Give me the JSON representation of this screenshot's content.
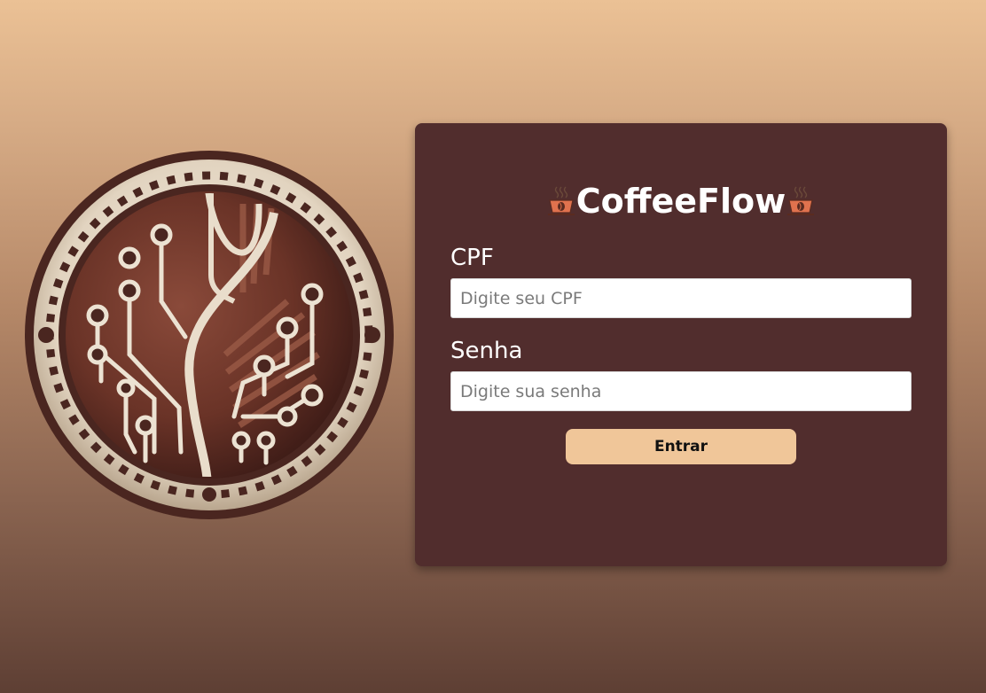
{
  "app": {
    "title": "CoffeeFlow",
    "title_icon": "coffee-cup-icon",
    "logo_icon": "coffee-bean-circuit-logo"
  },
  "login_form": {
    "cpf_label": "CPF",
    "cpf_placeholder": "Digite seu CPF",
    "cpf_value": "",
    "password_label": "Senha",
    "password_placeholder": "Digite sua senha",
    "password_value": "",
    "submit_label": "Entrar"
  },
  "colors": {
    "card_background": "#512d2d",
    "button_background": "#f0c699",
    "page_gradient_top": "#ebc195",
    "page_gradient_bottom": "#5e3f34"
  }
}
